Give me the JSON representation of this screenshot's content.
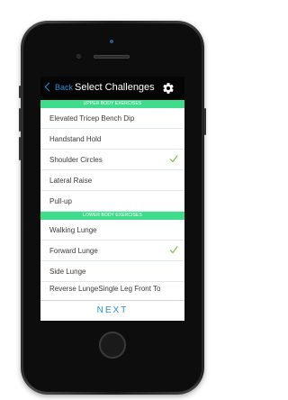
{
  "nav": {
    "back_label": "Back",
    "title": "Select Challenges",
    "settings_icon": "gear-icon"
  },
  "sections": [
    {
      "header": "UPPER BODY EXERCISES",
      "items": [
        {
          "label": "Elevated Tricep Bench Dip",
          "checked": false
        },
        {
          "label": "Handstand Hold",
          "checked": false
        },
        {
          "label": "Shoulder Circles",
          "checked": true
        },
        {
          "label": "Lateral Raise",
          "checked": false
        },
        {
          "label": "Pull-up",
          "checked": false
        }
      ]
    },
    {
      "header": "LOWER BODY EXERCISES",
      "items": [
        {
          "label": "Walking Lunge",
          "checked": false
        },
        {
          "label": "Forward Lunge",
          "checked": true
        },
        {
          "label": "Side Lunge",
          "checked": false
        },
        {
          "label": "Reverse LungeSingle Leg Front To",
          "checked": false
        }
      ]
    }
  ],
  "footer": {
    "next_label": "NEXT"
  },
  "colors": {
    "accent": "#2f8ed6",
    "section": "#3fdc8c",
    "check": "#7ac142",
    "navbar": "#050505"
  }
}
